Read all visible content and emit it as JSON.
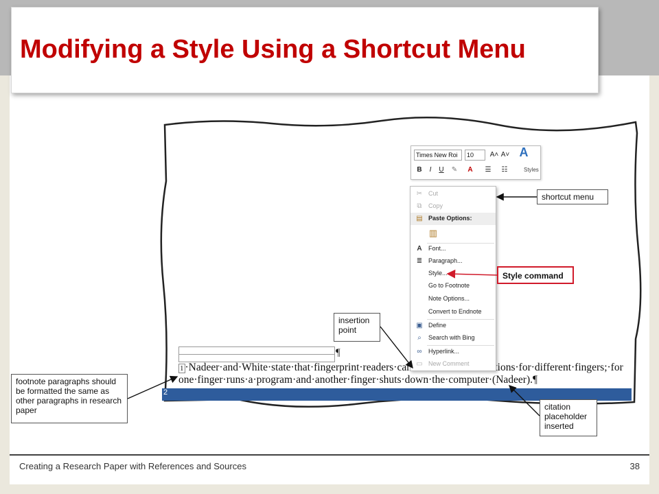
{
  "slide": {
    "title": "Modifying a Style Using a Shortcut Menu",
    "footer": "Creating a Research Paper with References and Sources",
    "page_number": "38"
  },
  "document": {
    "footnote_mark": "1",
    "line1": "·Nadeer·and·White·state·that·fingerprint·readers·can·",
    "line1_tail": "unctions·for·different·fingers;·for",
    "line2": "one·finger·runs·a·program·and·another·finger·shuts·down·the·computer·(Nadeer).¶",
    "pilcrow": "¶",
    "status_glyph": "2"
  },
  "mini_toolbar": {
    "font_name": "Times New Roi",
    "font_size": "10",
    "grow_label": "A˄",
    "shrink_label": "A˅",
    "styles_label": "Styles",
    "bold": "B",
    "italic": "I",
    "underline": "U",
    "font_color": "A"
  },
  "context_menu": {
    "items": [
      {
        "label": "Cut",
        "icon": "scissors-icon",
        "glyph": "✂",
        "disabled": true
      },
      {
        "label": "Copy",
        "icon": "copy-icon",
        "glyph": "⧉",
        "disabled": true
      },
      {
        "label": "Paste Options:",
        "icon": "clipboard-icon",
        "glyph": "📋",
        "header": true
      },
      {
        "label": "Font...",
        "icon": "font-icon",
        "glyph": "A"
      },
      {
        "label": "Paragraph...",
        "icon": "paragraph-icon",
        "glyph": "≡"
      },
      {
        "label": "Style...",
        "icon": "style-icon",
        "glyph": ""
      },
      {
        "label": "Go to Footnote",
        "icon": "",
        "glyph": ""
      },
      {
        "label": "Note Options...",
        "icon": "",
        "glyph": ""
      },
      {
        "label": "Convert to Endnote",
        "icon": "",
        "glyph": ""
      },
      {
        "label": "Define",
        "icon": "define-icon",
        "glyph": "▣"
      },
      {
        "label": "Search with Bing",
        "icon": "search-icon",
        "glyph": "⌕"
      },
      {
        "label": "Hyperlink...",
        "icon": "hyperlink-icon",
        "glyph": "∞"
      },
      {
        "label": "New Comment",
        "icon": "comment-icon",
        "glyph": "▭",
        "disabled": true
      }
    ]
  },
  "callouts": {
    "shortcut_menu": "shortcut menu",
    "style_command": "Style command",
    "insertion_point": "insertion point",
    "footnote_paragraphs": "footnote paragraphs should be formatted the same as other paragraphs in research paper",
    "citation_placeholder": "citation placeholder inserted"
  },
  "colors": {
    "title": "#c00000",
    "highlight_red": "#d01a2a",
    "status_bar": "#2e5c9c",
    "top_band": "#b8b8b8"
  }
}
